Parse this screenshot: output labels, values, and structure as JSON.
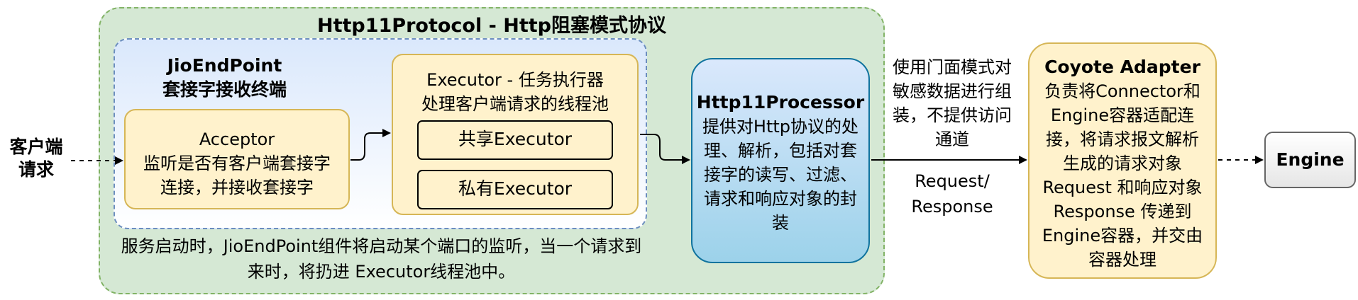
{
  "client": {
    "label": "客户端\n请求"
  },
  "protocol": {
    "title": "Http11Protocol - Http阻塞模式协议",
    "note": "服务启动时，JioEndPoint组件将启动某个端口的监听，当一个请求到来时，将扔进 Executor线程池中。"
  },
  "endpoint": {
    "title": "JioEndPoint\n套接字接收终端",
    "acceptor": {
      "title": "Acceptor",
      "desc": "监听是否有客户端套接字连接，并接收套接字"
    },
    "executor": {
      "title": "Executor - 任务执行器",
      "desc": "处理客户端请求的线程池",
      "shared": "共享Executor",
      "private": "私有Executor"
    }
  },
  "processor": {
    "title": "Http11Processor",
    "desc": "提供对Http协议的处理、解析，包括对套接字的读写、过滤、请求和响应对象的封装"
  },
  "facade_note": "使用门面模式对敏感数据进行组装，不提供访问通道",
  "request_response_label": "Request/\nResponse",
  "adapter": {
    "title": "Coyote Adapter",
    "desc": "负责将Connector和Engine容器适配连接，将请求报文解析生成的请求对象Request 和响应对象 Response 传递到Engine容器，并交由容器处理"
  },
  "engine": {
    "label": "Engine"
  },
  "colors": {
    "protocol_fill": "#d5e8d4",
    "protocol_stroke": "#82b366",
    "endpoint_stroke": "#6c8ebf",
    "yellow_fill": "#fff2cc",
    "yellow_stroke": "#d6b656",
    "processor_stroke": "#10739e",
    "engine_stroke": "#666666"
  }
}
